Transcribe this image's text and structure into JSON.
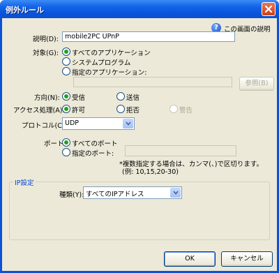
{
  "title": "例外ルール",
  "help_link": "この画面の説明",
  "description": {
    "label": "説明(D):",
    "value": "mobile2PC UPnP"
  },
  "target": {
    "label": "対象(G):",
    "options": [
      "すべてのアプリケーション",
      "システムプログラム",
      "指定のアプリケーション:"
    ],
    "app_path": "",
    "browse_button": "参照(B)"
  },
  "direction": {
    "label": "方向(N):",
    "options": [
      "受信",
      "送信"
    ]
  },
  "access": {
    "label": "アクセス処理(A):",
    "options": [
      "許可",
      "拒否",
      "警告"
    ]
  },
  "protocol": {
    "label": "プロトコル(C):",
    "value": "UDP"
  },
  "port": {
    "label": "ポート:",
    "options": [
      "すべてのポート",
      "指定のポート:"
    ],
    "value": "",
    "note_line1": "*複数指定する場合は、カンマ(、)で区切ります。",
    "note_line2": "(例: 10,15,20-30)"
  },
  "ip": {
    "group_title": "IP設定",
    "type_label": "種類(Y):",
    "type_value": "すべてのIPアドレス"
  },
  "buttons": {
    "ok": "OK",
    "cancel": "キャンセル"
  },
  "colors": {
    "title_bar": "#0a55dc",
    "dialog_bg": "#ece9d8",
    "radio_dot": "#21a121",
    "group_title": "#0046d5"
  }
}
